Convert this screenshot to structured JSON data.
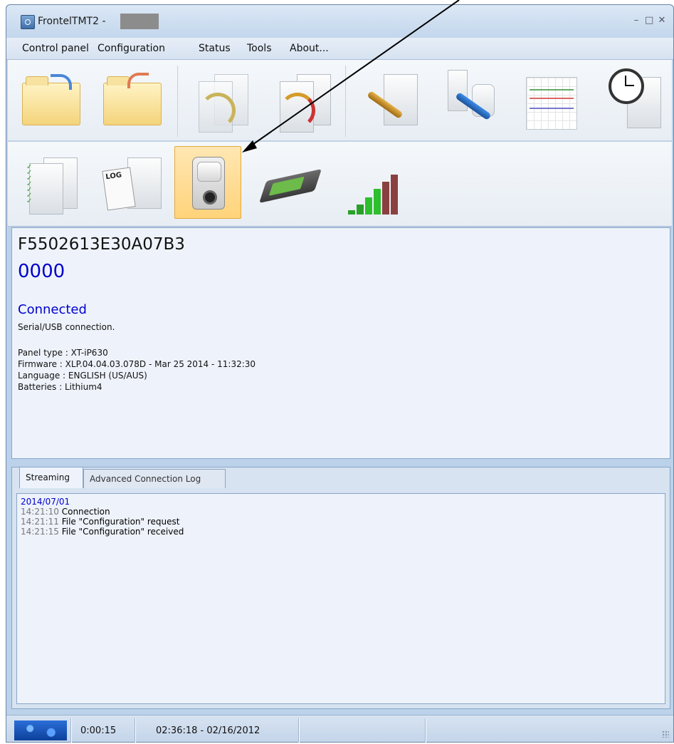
{
  "window": {
    "title": "FrontelTMT2 -",
    "controls": [
      "minimize-icon",
      "maximize-icon",
      "close-icon"
    ]
  },
  "menu": [
    "Control panel",
    "Configuration",
    "Status",
    "Tools",
    "About..."
  ],
  "toolbar_row1": [
    {
      "icon": "open-folder-icon"
    },
    {
      "icon": "revert-folder-icon"
    },
    {
      "icon": "panel-download-icon"
    },
    {
      "icon": "panel-upload-icon"
    },
    {
      "icon": "panel-settings-icon"
    },
    {
      "icon": "devices-settings-icon"
    },
    {
      "icon": "schedule-icon"
    },
    {
      "icon": "clock-panel-icon"
    }
  ],
  "toolbar_row2": [
    {
      "icon": "panel-checklist-icon"
    },
    {
      "icon": "event-log-icon",
      "label": "LOG"
    },
    {
      "icon": "motion-detector-camera-icon",
      "active": true
    },
    {
      "icon": "switch-icon"
    },
    {
      "icon": "signal-strength-icon"
    }
  ],
  "info": {
    "device_id": "F5502613E30A07B3",
    "code": "0000",
    "status": "Connected",
    "connection": "Serial/USB connection.",
    "panel_type": "Panel type : XT-iP630",
    "firmware": "Firmware : XLP.04.04.03.078D - Mar 25 2014 - 11:32:30",
    "language": "Language : ENGLISH (US/AUS)",
    "batteries": "Batteries : Lithium4"
  },
  "tabs": [
    "Streaming",
    "Advanced Connection Log"
  ],
  "log": {
    "date": "2014/07/01",
    "entries": [
      {
        "time": "14:21:10",
        "text": "Connection"
      },
      {
        "time": "14:21:11",
        "text": "File \"Configuration\" request"
      },
      {
        "time": "14:21:15",
        "text": "File \"Configuration\" received"
      }
    ]
  },
  "statusbar": {
    "elapsed": "0:00:15",
    "datetime": "02:36:18 - 02/16/2012"
  },
  "colors": {
    "accent_blue": "#0000cc",
    "active_button": "#ffd37a",
    "frame": "#bcd2ea"
  }
}
